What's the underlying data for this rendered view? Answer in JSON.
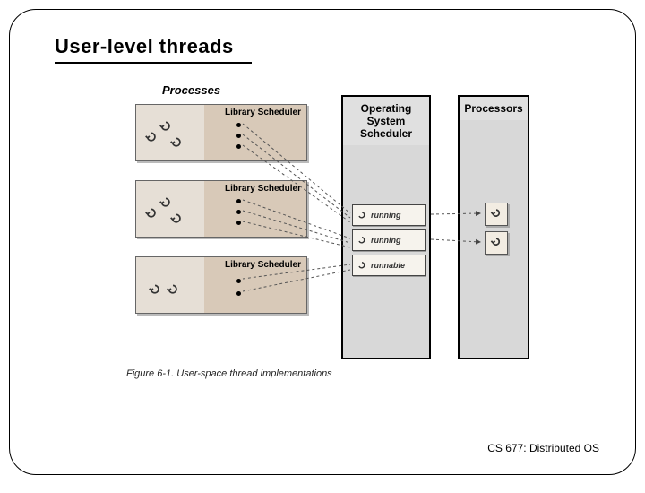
{
  "slide": {
    "title": "User-level threads",
    "footer": "CS 677: Distributed OS"
  },
  "diagram": {
    "caption": "Figure 6-1. User-space thread implementations",
    "columns": {
      "processes_header": "Processes",
      "os_header_line1": "Operating",
      "os_header_line2": "System",
      "os_header_line3": "Scheduler",
      "processors_header": "Processors"
    },
    "process_boxes": [
      {
        "label": "Library Scheduler",
        "thread_count": 3
      },
      {
        "label": "Library Scheduler",
        "thread_count": 3
      },
      {
        "label": "Library Scheduler",
        "thread_count": 2
      }
    ],
    "os_states": [
      {
        "label": "running"
      },
      {
        "label": "running"
      },
      {
        "label": "runnable"
      }
    ],
    "processors": [
      {
        "id": "cpu-0"
      },
      {
        "id": "cpu-1"
      }
    ]
  }
}
